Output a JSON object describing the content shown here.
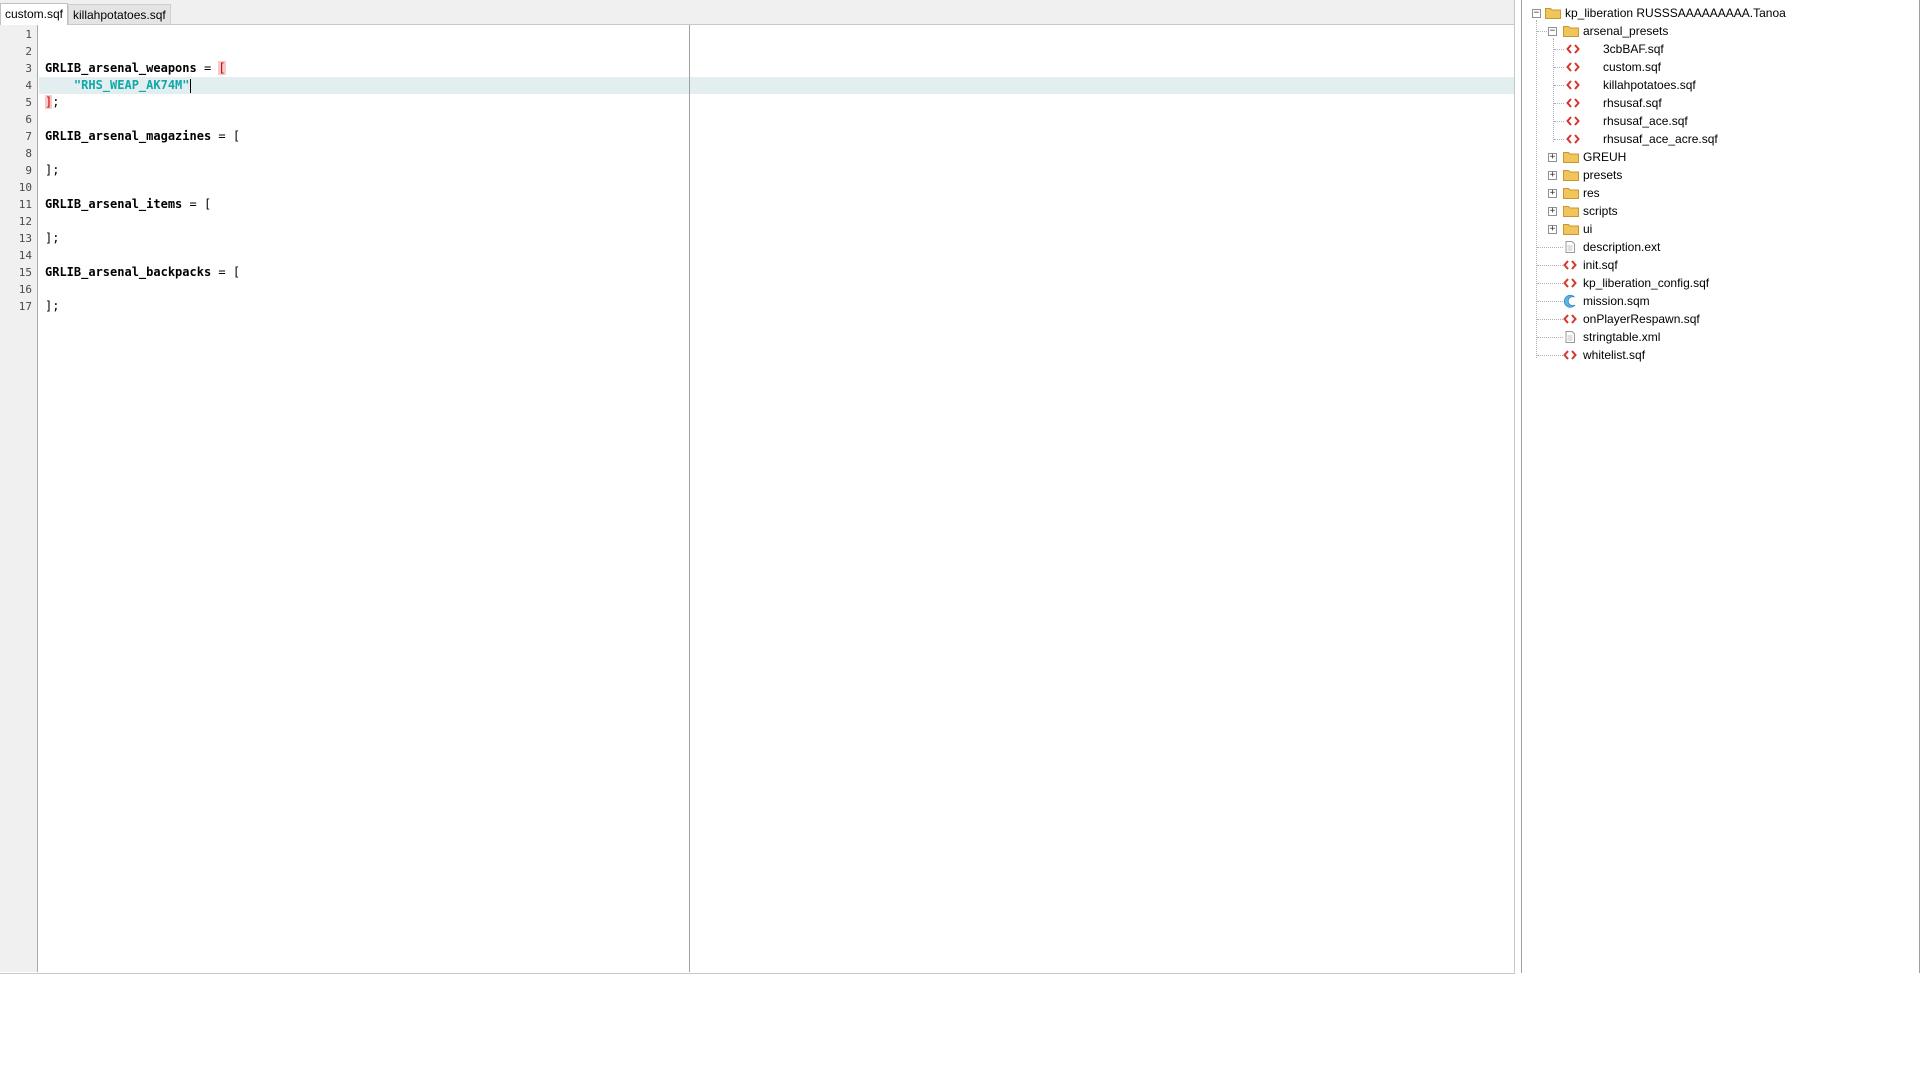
{
  "tabs": [
    {
      "label": "custom.sqf",
      "active": true
    },
    {
      "label": "killahpotatoes.sqf",
      "active": false
    }
  ],
  "editor": {
    "line_numbers": [
      "1",
      "2",
      "3",
      "4",
      "5",
      "6",
      "7",
      "8",
      "9",
      "10",
      "11",
      "12",
      "13",
      "14",
      "15",
      "16",
      "17"
    ],
    "current_line": 4,
    "lines": {
      "l3_ident": "GRLIB_arsenal_weapons",
      "l3_op": " = ",
      "l3_bracket": "[",
      "l4_indent": "    ",
      "l4_string": "\"RHS_WEAP_AK74M\"",
      "l5_bracket": "]",
      "l5_end": ";",
      "l7_ident": "GRLIB_arsenal_magazines",
      "l7_op": " = [",
      "l9_text": "];",
      "l11_ident": "GRLIB_arsenal_items",
      "l11_op": " = [",
      "l13_text": "];",
      "l15_ident": "GRLIB_arsenal_backpacks",
      "l15_op": " = [",
      "l17_text": "];"
    }
  },
  "tree": {
    "root": {
      "label": "kp_liberation RUSSSAAAAAAAAA.Tanoa",
      "expander": "−",
      "icon": "folder-icon"
    },
    "arsenal_presets": {
      "label": "arsenal_presets",
      "expander": "−",
      "icon": "folder-icon"
    },
    "preset_files": [
      {
        "label": "3cbBAF.sqf",
        "icon": "sqf-file-icon"
      },
      {
        "label": "custom.sqf",
        "icon": "sqf-file-icon"
      },
      {
        "label": "killahpotatoes.sqf",
        "icon": "sqf-file-icon"
      },
      {
        "label": "rhsusaf.sqf",
        "icon": "sqf-file-icon"
      },
      {
        "label": "rhsusaf_ace.sqf",
        "icon": "sqf-file-icon"
      },
      {
        "label": "rhsusaf_ace_acre.sqf",
        "icon": "sqf-file-icon"
      }
    ],
    "folders": [
      {
        "label": "GREUH",
        "expander": "+",
        "icon": "folder-icon"
      },
      {
        "label": "presets",
        "expander": "+",
        "icon": "folder-icon"
      },
      {
        "label": "res",
        "expander": "+",
        "icon": "folder-icon"
      },
      {
        "label": "scripts",
        "expander": "+",
        "icon": "folder-icon"
      },
      {
        "label": "ui",
        "expander": "+",
        "icon": "folder-icon"
      }
    ],
    "root_files": [
      {
        "label": "description.ext",
        "icon": "text-file-icon"
      },
      {
        "label": "init.sqf",
        "icon": "sqf-file-icon"
      },
      {
        "label": "kp_liberation_config.sqf",
        "icon": "sqf-file-icon"
      },
      {
        "label": "mission.sqm",
        "icon": "mission-file-icon"
      },
      {
        "label": "onPlayerRespawn.sqf",
        "icon": "sqf-file-icon"
      },
      {
        "label": "stringtable.xml",
        "icon": "text-file-icon"
      },
      {
        "label": "whitelist.sqf",
        "icon": "sqf-file-icon"
      }
    ]
  },
  "colors": {
    "current_line": "#e3eef0",
    "string": "#10a8a8",
    "bracket_match_bg": "#f7c9c9",
    "sqf_icon": "#d9342b",
    "folder": "#f2c55c"
  }
}
